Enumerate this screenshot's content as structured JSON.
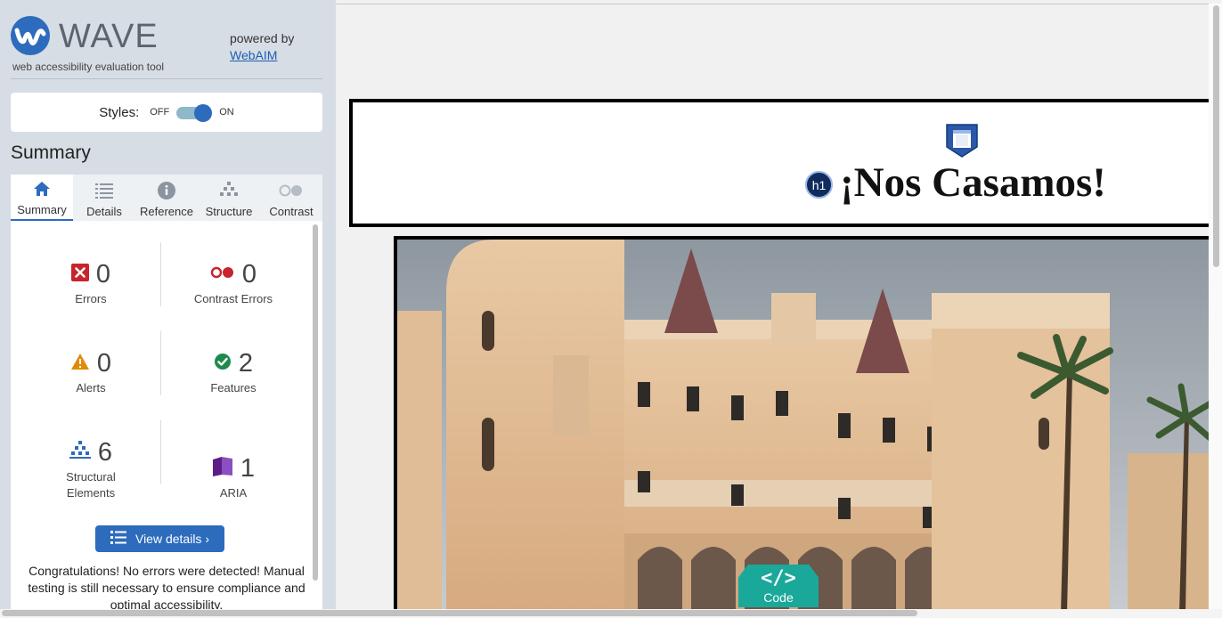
{
  "brand": {
    "logo_text": "WAVE",
    "subtitle": "web accessibility evaluation tool",
    "powered_by": "powered by",
    "webaim_link": "WebAIM"
  },
  "styles_toggle": {
    "label": "Styles:",
    "off": "OFF",
    "on": "ON",
    "state": "on"
  },
  "summary_title": "Summary",
  "tabs": [
    {
      "label": "Summary",
      "icon": "home-icon",
      "active": true
    },
    {
      "label": "Details",
      "icon": "list-icon",
      "active": false
    },
    {
      "label": "Reference",
      "icon": "info-icon",
      "active": false
    },
    {
      "label": "Structure",
      "icon": "structure-icon",
      "active": false
    },
    {
      "label": "Contrast",
      "icon": "contrast-icon",
      "active": false
    }
  ],
  "stats": {
    "errors": {
      "value": "0",
      "label": "Errors",
      "icon": "error-icon",
      "color": "#c7242d"
    },
    "contrast": {
      "value": "0",
      "label": "Contrast Errors",
      "icon": "contrast-error-icon",
      "color": "#c7242d"
    },
    "alerts": {
      "value": "0",
      "label": "Alerts",
      "icon": "alert-icon",
      "color": "#e08a0b"
    },
    "features": {
      "value": "2",
      "label": "Features",
      "icon": "feature-check-icon",
      "color": "#1e8a4c"
    },
    "structural": {
      "value": "6",
      "label": "Structural Elements",
      "icon": "structure-icon",
      "color": "#2d6bbd"
    },
    "aria": {
      "value": "1",
      "label": "ARIA",
      "icon": "aria-icon",
      "color": "#5c1d87"
    }
  },
  "view_details": "View details ›",
  "congrats": "Congratulations! No errors were detected! Manual testing is still necessary to ensure compliance and optimal accessibility.",
  "page": {
    "h1_badge": "h1",
    "headline": "¡Nos Casamos!",
    "code_symbol": "</>",
    "code_label": "Code"
  },
  "colors": {
    "accent": "#2d6bbd",
    "sidebar_bg": "#d7dde4",
    "code_button": "#1aa89b"
  }
}
